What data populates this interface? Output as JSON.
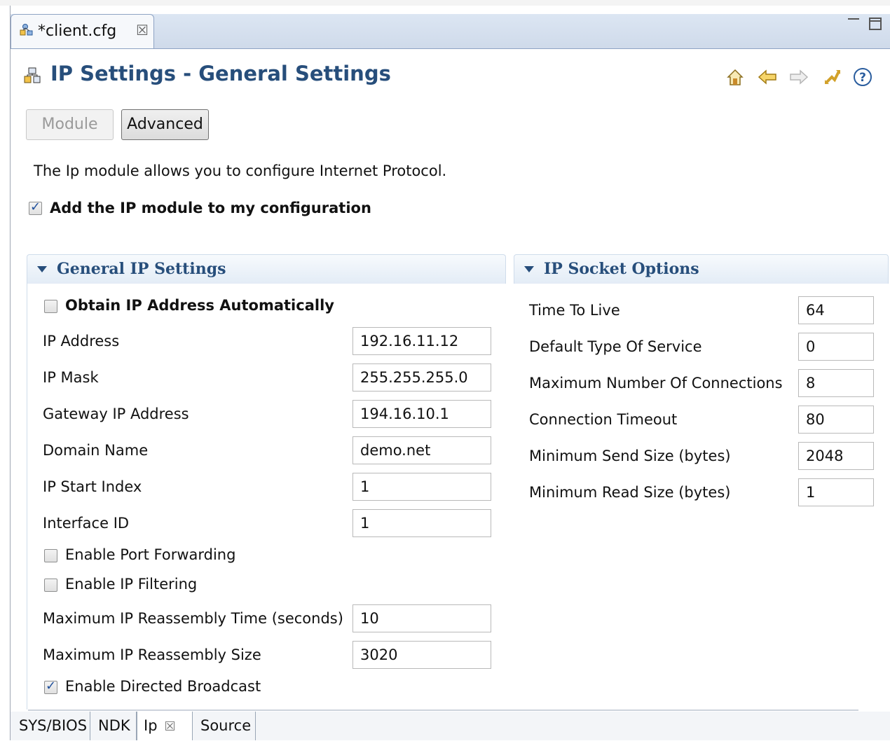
{
  "editor": {
    "tab_title": "*client.cfg",
    "tab_close": "☒"
  },
  "page": {
    "title": "IP Settings - General Settings",
    "buttons": {
      "module": "Module",
      "advanced": "Advanced"
    },
    "description": "The Ip module allows you to configure Internet Protocol.",
    "add_module_label": "Add the IP module to my configuration",
    "add_module_checked": true
  },
  "general": {
    "title": "General IP Settings",
    "obtain_auto_label": "Obtain IP Address Automatically",
    "fields": [
      {
        "label": "IP Address",
        "value": "192.16.11.12"
      },
      {
        "label": "IP Mask",
        "value": "255.255.255.0"
      },
      {
        "label": "Gateway IP Address",
        "value": "194.16.10.1"
      },
      {
        "label": "Domain Name",
        "value": "demo.net"
      },
      {
        "label": "IP Start Index",
        "value": "1"
      },
      {
        "label": "Interface ID",
        "value": "1"
      }
    ],
    "port_forwarding_label": "Enable Port Forwarding",
    "ip_filtering_label": "Enable IP Filtering",
    "fields2": [
      {
        "label": "Maximum IP Reassembly Time (seconds)",
        "value": "10"
      },
      {
        "label": "Maximum IP Reassembly Size",
        "value": "3020"
      }
    ],
    "directed_broadcast_label": "Enable Directed Broadcast"
  },
  "socket": {
    "title": "IP Socket Options",
    "fields": [
      {
        "label": "Time To Live",
        "value": "64"
      },
      {
        "label": "Default Type Of Service",
        "value": "0"
      },
      {
        "label": "Maximum Number Of Connections",
        "value": "8"
      },
      {
        "label": "Connection Timeout",
        "value": "80"
      },
      {
        "label": "Minimum Send Size (bytes)",
        "value": "2048"
      },
      {
        "label": "Minimum Read Size (bytes)",
        "value": "1"
      }
    ]
  },
  "bottom_tabs": [
    {
      "label": "SYS/BIOS"
    },
    {
      "label": "NDK"
    },
    {
      "label": "Ip",
      "close": "☒"
    },
    {
      "label": "Source"
    }
  ]
}
